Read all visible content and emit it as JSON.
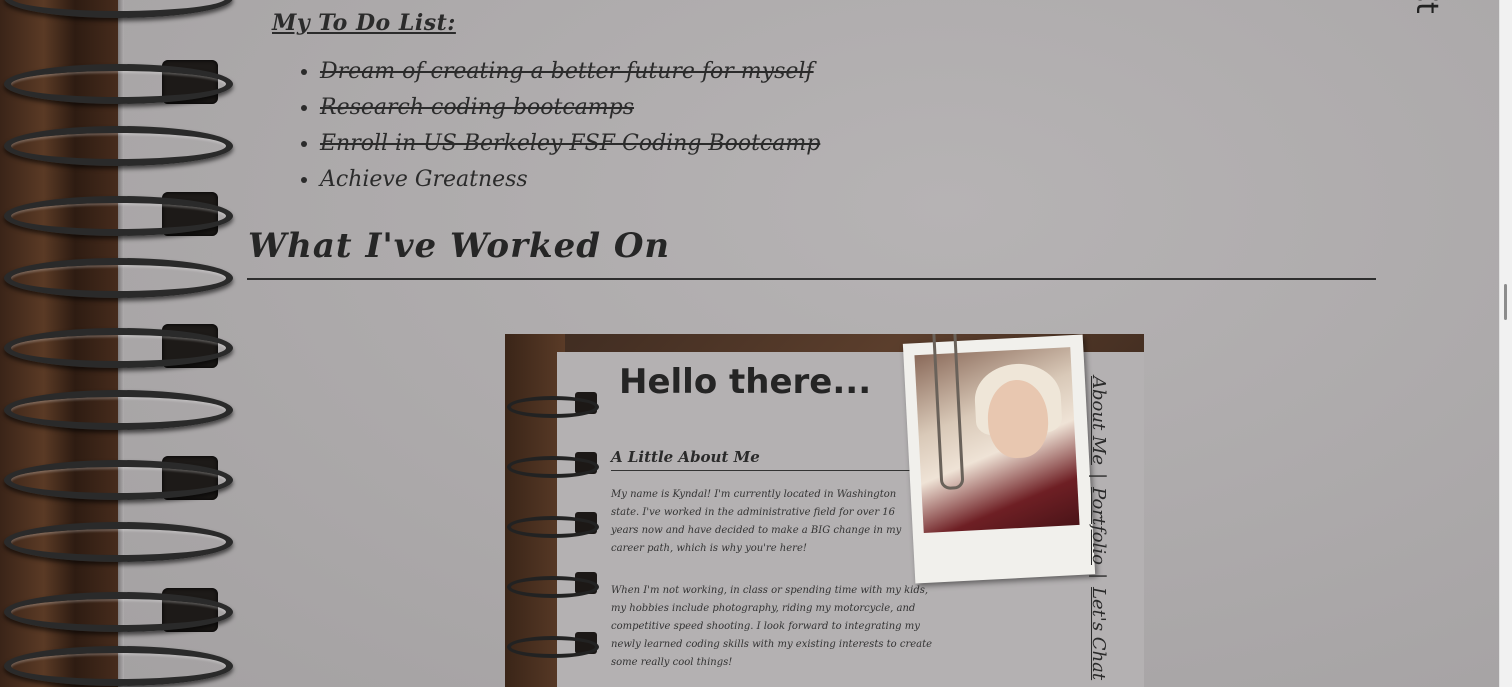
{
  "nav": {
    "fragment": "Ct"
  },
  "todo": {
    "title": "My To Do List:",
    "items": [
      {
        "label": "Dream of creating a better future for myself",
        "done": true
      },
      {
        "label": "Research coding bootcamps",
        "done": true
      },
      {
        "label": "Enroll in US Berkeley FSF Coding Bootcamp",
        "done": true
      },
      {
        "label": "Achieve Greatness",
        "done": false
      }
    ]
  },
  "work": {
    "title": "What I've Worked On"
  },
  "project": {
    "heading": "Hello there...",
    "subheading": "A Little About Me",
    "para1": "My name is Kyndal! I'm currently located in Washington state. I've worked in the administrative field for over 16 years now and have decided to make a BIG change in my career path, which is why you're here!",
    "para2": "When I'm not working, in class or spending time with my kids, my hobbies include photography, riding my motorcycle, and competitive speed shooting. I look forward to integrating my newly learned coding skills with my existing interests to create some really cool things!",
    "nav": {
      "about": "About Me",
      "portfolio": "Portfolio",
      "contact": "Let's Chat",
      "separator": "|"
    }
  }
}
